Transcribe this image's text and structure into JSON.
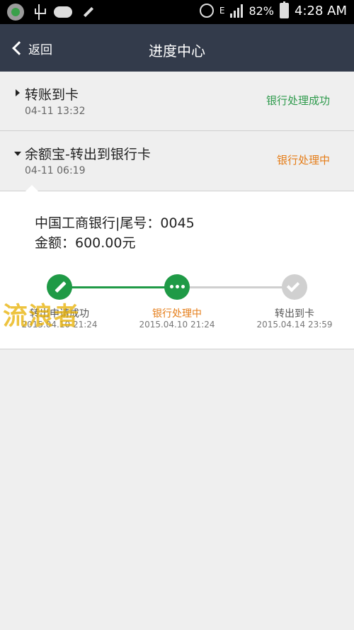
{
  "status_bar": {
    "battery": "82%",
    "time": "4:28 AM",
    "network": "E"
  },
  "nav": {
    "back_label": "返回",
    "title": "进度中心"
  },
  "records": [
    {
      "title": "转账到卡",
      "time": "04-11 13:32",
      "status": "银行处理成功"
    },
    {
      "title": "余额宝-转出到银行卡",
      "time": "04-11 06:19",
      "status": "银行处理中"
    }
  ],
  "detail": {
    "bank_line": "中国工商银行|尾号：0045",
    "amount_line": "金额：600.00元",
    "steps": [
      {
        "label": "转出申请成功",
        "date": "2015.04.10 21:24"
      },
      {
        "label": "银行处理中",
        "date": "2015.04.10 21:24"
      },
      {
        "label": "转出到卡",
        "date": "2015.04.14 23:59"
      }
    ]
  },
  "watermark": "流浪者",
  "colors": {
    "nav_bg": "#333b4b",
    "success": "#2e9a4c",
    "pending": "#e57d18",
    "progress_done": "#1f9a46",
    "progress_todo": "#cfcfcf"
  }
}
